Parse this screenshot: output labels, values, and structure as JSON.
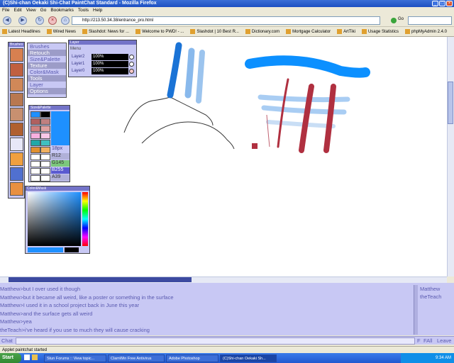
{
  "window": {
    "title": "(C)Shi-chan Oekaki Shi-Chat PaintChat Standard - Mozilla Firefox"
  },
  "menu": [
    "File",
    "Edit",
    "View",
    "Go",
    "Bookmarks",
    "Tools",
    "Help"
  ],
  "nav": {
    "url": "http://213.50.34.38/entrance_pro.html",
    "go_label": "Go"
  },
  "bookmarks": [
    "Latest Headlines",
    "Wired News",
    "Slashdot: News for ...",
    "Welcome to PWD! - ...",
    "Slashdot | 10 Best R...",
    "Dictionary.com",
    "Mortgage Calculator",
    "ArtTiki",
    "Usage Statistics",
    "phpMyAdmin 2.4.0"
  ],
  "paint": {
    "menu_title": "Brushes",
    "menu_items": [
      "Brushes",
      "Retouch",
      "Size&Palette",
      "Texture",
      "Color&Mask",
      "Tools",
      "Layer",
      "Options"
    ],
    "layer_panel": {
      "title": "Layer",
      "menu": "Menu",
      "layers": [
        {
          "name": "Layer2",
          "opacity": "100%"
        },
        {
          "name": "Layer1",
          "opacity": "100%"
        },
        {
          "name": "Layer0",
          "opacity": "100%"
        }
      ]
    },
    "size_panel": {
      "title": "Size&Palette",
      "size": "18px",
      "r": "R12",
      "g": "G145",
      "b": "B255",
      "a": "A39"
    },
    "color_panel": {
      "title": "Color&Mask"
    }
  },
  "chat": {
    "messages": [
      "Matthew>but I over used it though",
      "Matthew>but it became all weird, like a poster or something in the surface",
      "Matthew>I used it in a school project back in June this year",
      "Matthew>and the surface gets all weird",
      "Matthew>yea",
      "theTeach>i've heard if you use to much they will cause cracking"
    ],
    "users": [
      "Matthew",
      "theTeach"
    ],
    "input_label": "Chat",
    "btn_f": "F",
    "btn_fall": "FAll",
    "btn_leave": "Leave"
  },
  "status": "Applet paintchat started",
  "taskbar": {
    "start": "Start",
    "tasks": [
      "Stun Forums :: View topic...",
      "ClamWin Free Antivirus",
      "Adobe Photoshop",
      "(C)Shi-chan Oekaki Sh..."
    ],
    "clock": "9:34 AM"
  },
  "colors": {
    "accent_blue": "#0c90ff",
    "accent_red": "#b03040",
    "panel_bg": "#c8c8f4"
  }
}
